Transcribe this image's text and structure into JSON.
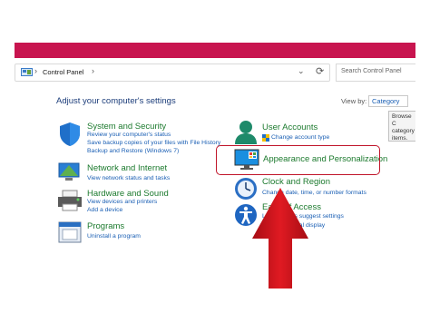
{
  "window": {
    "accent_color": "#c8154f"
  },
  "addressbar": {
    "path_label": "Control Panel",
    "separator": "›",
    "chevron": "⌄",
    "refresh": "⟳"
  },
  "search": {
    "placeholder": "Search Control Panel"
  },
  "main": {
    "heading": "Adjust your computer's settings",
    "view_by_label": "View by:",
    "view_by_value": "Category",
    "tooltip_text": "Browse C category items."
  },
  "left_categories": [
    {
      "title": "System and Security",
      "links": [
        "Review your computer's status",
        "Save backup copies of your files with File History",
        "Backup and Restore (Windows 7)"
      ],
      "icon": "shield-icon"
    },
    {
      "title": "Network and Internet",
      "links": [
        "View network status and tasks"
      ],
      "icon": "network-icon"
    },
    {
      "title": "Hardware and Sound",
      "links": [
        "View devices and printers",
        "Add a device"
      ],
      "icon": "printer-icon"
    },
    {
      "title": "Programs",
      "links": [
        "Uninstall a program"
      ],
      "icon": "programs-icon"
    }
  ],
  "right_categories": [
    {
      "title": "User Accounts",
      "links": [
        "Change account type"
      ],
      "icon": "user-icon"
    },
    {
      "title": "Appearance and Personalization",
      "links": [],
      "icon": "monitor-icon"
    },
    {
      "title": "Clock and Region",
      "links": [
        "Change date, time, or number formats"
      ],
      "icon": "clock-icon"
    },
    {
      "title": "Ease of Access",
      "links": [
        "Let Windows suggest settings",
        "Optimize visual display"
      ],
      "icon": "accessibility-icon"
    }
  ],
  "annotation": {
    "highlight_color": "#c0152a",
    "arrow_color": "#d0121b"
  }
}
